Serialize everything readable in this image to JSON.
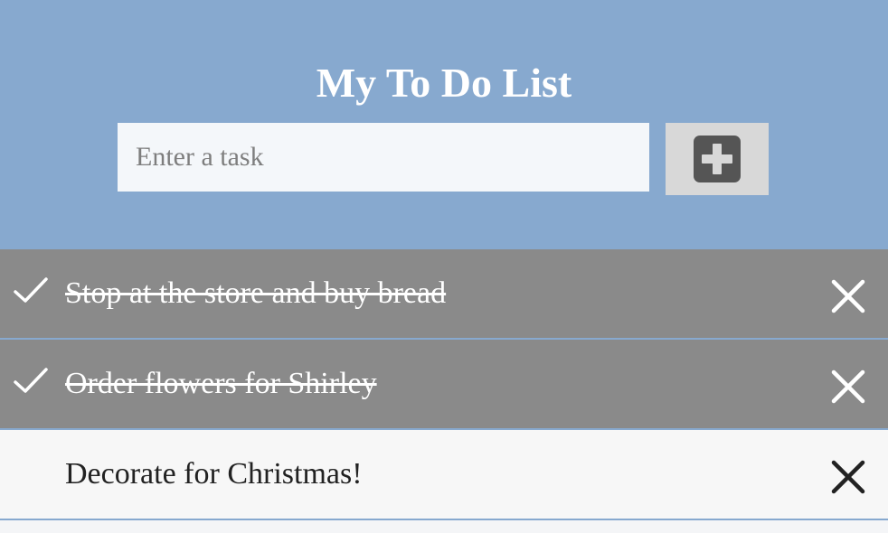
{
  "header": {
    "title": "My To Do List",
    "background_color": "#87a9cf"
  },
  "input": {
    "placeholder": "Enter a task",
    "value": ""
  },
  "add_button": {
    "icon": "plus-square-icon"
  },
  "tasks": [
    {
      "text": "Stop at the store and buy bread",
      "completed": true
    },
    {
      "text": "Order flowers for Shirley",
      "completed": true
    },
    {
      "text": "Decorate for Christmas!",
      "completed": false
    }
  ],
  "colors": {
    "completed_row": "#8a8a8a",
    "open_row": "#f7f7f7",
    "add_button_bg": "#d8d8d8",
    "add_icon": "#555555"
  }
}
